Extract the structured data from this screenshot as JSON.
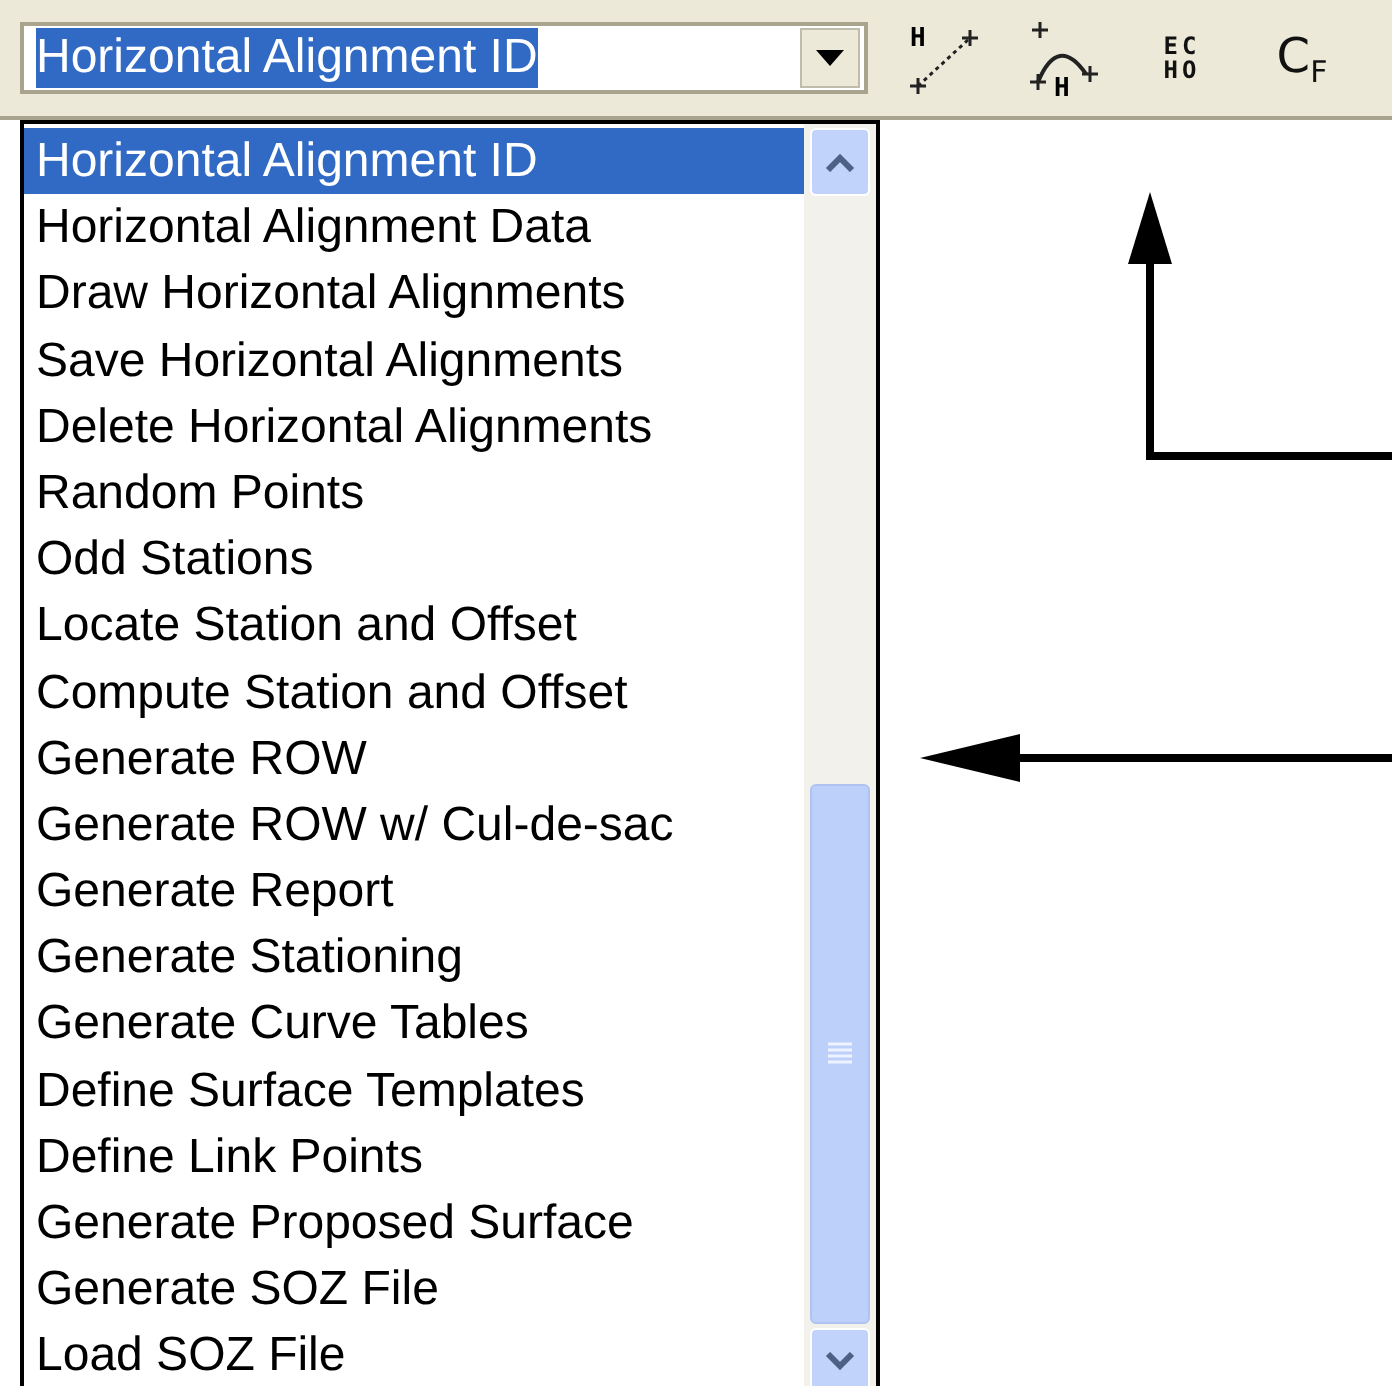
{
  "combo": {
    "value": "Horizontal Alignment ID"
  },
  "toolbar": [
    {
      "kind": "line",
      "label": "H"
    },
    {
      "kind": "curve",
      "label": "H"
    },
    {
      "kind": "stack",
      "lines": [
        "EC",
        "HO"
      ]
    },
    {
      "kind": "sub",
      "label": "C$_{F}$"
    }
  ],
  "list": [
    {
      "label": "Horizontal Alignment ID",
      "selected": true
    },
    {
      "label": "Horizontal Alignment Data",
      "selected": false
    },
    {
      "label": "Draw Horizontal Alignments",
      "selected": false
    },
    {
      "label": "Save Horizontal Alignments",
      "selected": false
    },
    {
      "label": "Delete Horizontal Alignments",
      "selected": false
    },
    {
      "label": "Random Points",
      "selected": false
    },
    {
      "label": "Odd Stations",
      "selected": false
    },
    {
      "label": "Locate Station and Offset",
      "selected": false
    },
    {
      "label": "Compute Station and Offset",
      "selected": false
    },
    {
      "label": "Generate ROW",
      "selected": false
    },
    {
      "label": "Generate ROW w/ Cul-de-sac",
      "selected": false
    },
    {
      "label": "Generate Report",
      "selected": false
    },
    {
      "label": "Generate Stationing",
      "selected": false
    },
    {
      "label": "Generate Curve Tables",
      "selected": false
    },
    {
      "label": "Define Surface Templates",
      "selected": false
    },
    {
      "label": "Define Link Points",
      "selected": false
    },
    {
      "label": "Generate Proposed Surface",
      "selected": false
    },
    {
      "label": "Generate SOZ File",
      "selected": false
    },
    {
      "label": "Load SOZ File",
      "selected": false
    }
  ]
}
